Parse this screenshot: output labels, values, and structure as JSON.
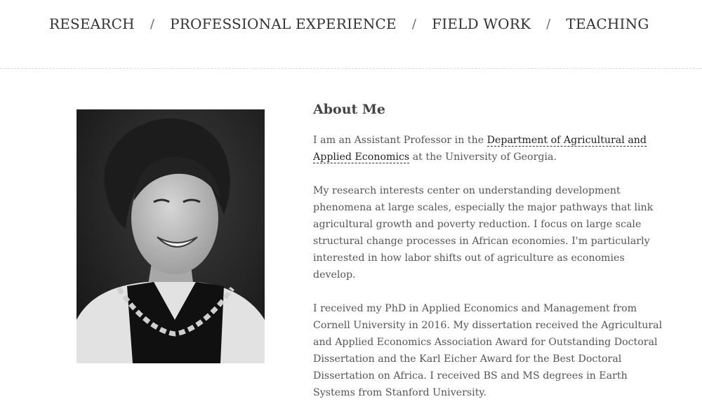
{
  "nav": {
    "items": [
      {
        "label": "RESEARCH"
      },
      {
        "label": "PROFESSIONAL EXPERIENCE"
      },
      {
        "label": "FIELD WORK"
      },
      {
        "label": "TEACHING"
      }
    ],
    "separator": "/"
  },
  "about": {
    "heading": "About Me",
    "p1": {
      "before": "I am an Assistant Professor in the ",
      "link": "Department of Agricultural and Applied Economics",
      "after": " at the University of Georgia."
    },
    "p2": "My research interests center on understanding development phenomena at large scales, especially the major pathways that link agricultural growth and poverty reduction. I focus on large scale structural change processes in African economies. I'm particularly interested in how labor shifts out of agriculture as economies develop.",
    "p3": "I received my PhD in Applied Economics and Management from Cornell University in 2016. My dissertation received the Agricultural and Applied Economics Association Award for Outstanding Doctoral Dissertation and the Karl Eicher Award for the Best Doctoral Dissertation on Africa. I received BS and MS degrees in Earth Systems from Stanford University."
  },
  "colors": {
    "text": "#555555",
    "nav_text": "#333333",
    "link_underline": "#333333",
    "divider": "#d9d9d9"
  }
}
